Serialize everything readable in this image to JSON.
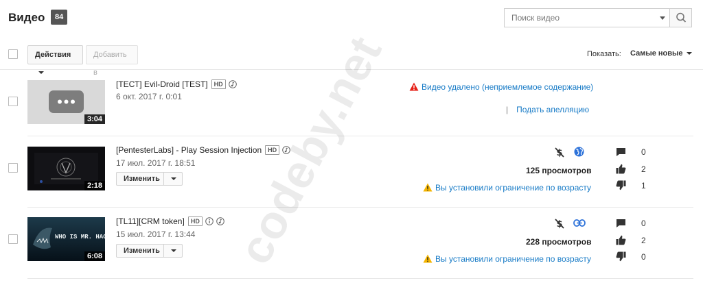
{
  "header": {
    "title": "Видео",
    "count": "84",
    "search": {
      "placeholder": "Поиск видео",
      "icon": "search-icon"
    }
  },
  "toolbar": {
    "actions_label": "Действия",
    "add_to_label": "Добавить в",
    "show_label": "Показать:",
    "sort_value": "Самые новые"
  },
  "watermark": "codeby.net",
  "colors": {
    "link": "#167ac6",
    "warning_red": "#e62117",
    "warning_yellow": "#f4b400",
    "icon_dark": "#333333"
  },
  "videos": [
    {
      "title": "[ТЕСТ] Evil-Droid [TEST]",
      "hd": "HD",
      "date": "6 окт. 2017 г. 0:01",
      "duration": "3:04",
      "status": "Видео удалено (неприемлемое содержание)",
      "appeal": "Подать апелляцию",
      "pipe": "|"
    },
    {
      "title": "[PentesterLabs] - Play Session Injection",
      "hd": "HD",
      "date": "17 июл. 2017 г. 18:51",
      "duration": "2:18",
      "edit": "Изменить",
      "views": "125 просмотров",
      "warning": "Вы установили ограничение по возрасту",
      "visibility": "globe-icon",
      "comments": "0",
      "likes": "2",
      "dislikes": "1"
    },
    {
      "title": "[TL11][CRM token]",
      "hd": "HD",
      "date": "15 июл. 2017 г. 13:44",
      "duration": "6:08",
      "edit": "Изменить",
      "views": "228 просмотров",
      "warning": "Вы установили ограничение по возрасту",
      "visibility": "link-icon",
      "comments": "0",
      "likes": "2",
      "dislikes": "0",
      "thumb_text": "WHO IS MR. HACKER?"
    }
  ]
}
